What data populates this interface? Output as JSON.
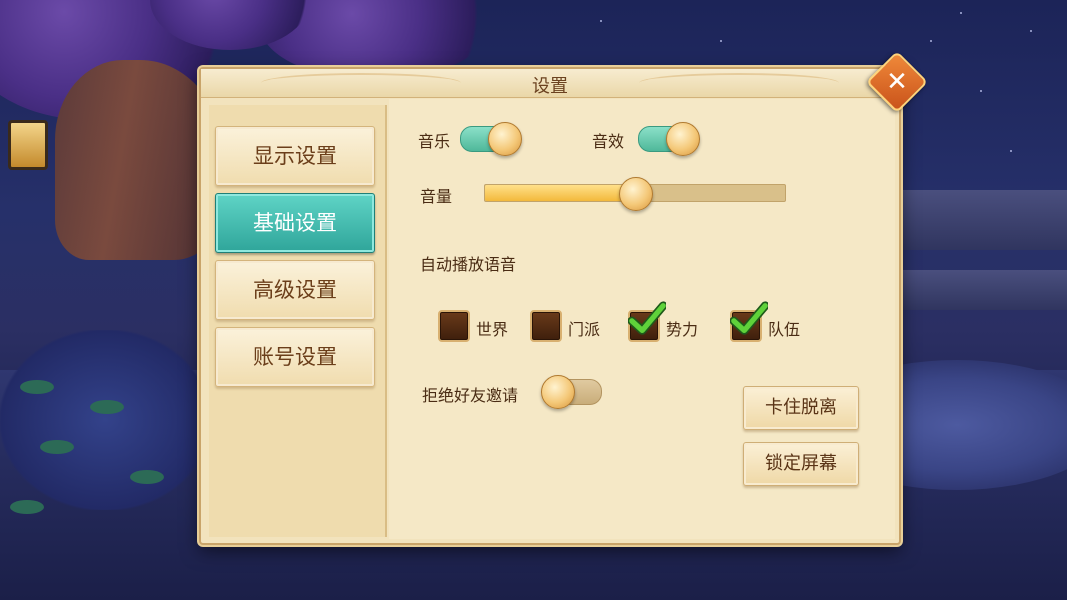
{
  "dialog": {
    "title": "设置"
  },
  "nav": {
    "items": [
      {
        "label": "显示设置",
        "active": false
      },
      {
        "label": "基础设置",
        "active": true
      },
      {
        "label": "高级设置",
        "active": false
      },
      {
        "label": "账号设置",
        "active": false
      }
    ]
  },
  "audio": {
    "music_label": "音乐",
    "music_on": true,
    "sfx_label": "音效",
    "sfx_on": true,
    "volume_label": "音量",
    "volume_level": 0.5
  },
  "voice": {
    "label": "自动播放语音",
    "channels": [
      {
        "label": "世界",
        "checked": false
      },
      {
        "label": "门派",
        "checked": false
      },
      {
        "label": "势力",
        "checked": true
      },
      {
        "label": "队伍",
        "checked": true
      }
    ]
  },
  "friends": {
    "reject_invite_label": "拒绝好友邀请",
    "reject_invite_on": false
  },
  "actions": {
    "unstuck_label": "卡住脱离",
    "lock_screen_label": "锁定屏幕"
  },
  "colors": {
    "accent": "#2fa59a",
    "panel": "#f2e3bd",
    "close": "#e0702a"
  }
}
